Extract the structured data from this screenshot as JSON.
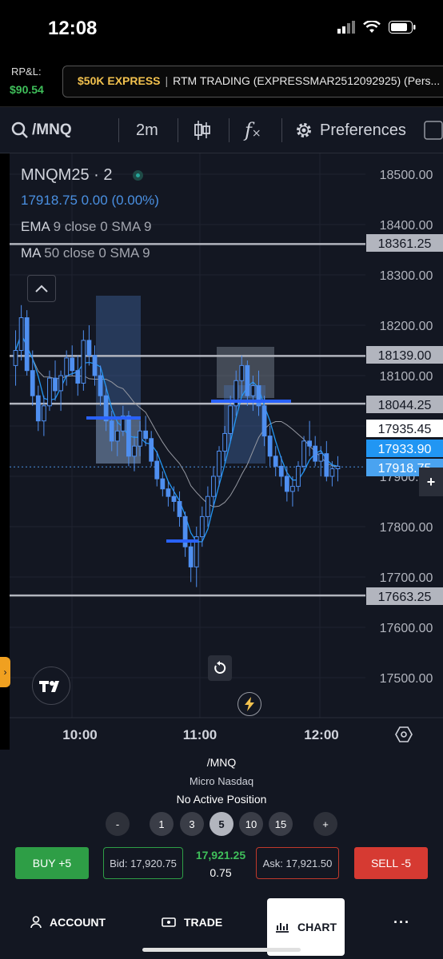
{
  "status_bar": {
    "time": "12:08"
  },
  "account": {
    "rpl_label": "RP&L:",
    "rpl_value": "$90.54",
    "express_label": "$50K EXPRESS",
    "separator": "|",
    "account_name": "RTM TRADING (EXPRESSMAR2512092925) (Pers..."
  },
  "toolbar": {
    "symbol": "/MNQ",
    "interval": "2m",
    "preferences_label": "Preferences",
    "fx_label": "f"
  },
  "legend": {
    "symbol_line": "MNQM25 · 2",
    "price_line": "17918.75  0.00 (0.00%)",
    "ema_label": "EMA",
    "ema_params": "9 close 0 SMA 9",
    "ma_label": "MA",
    "ma_params": "50 close 0 SMA 9"
  },
  "price_axis": {
    "ticks": [
      "18500.00",
      "18400.00",
      "18300.00",
      "18200.00",
      "18100.00",
      "17900.00",
      "17800.00",
      "17700.00",
      "17600.00",
      "17500.00"
    ],
    "labels": [
      {
        "text": "18361.25",
        "style": "gray"
      },
      {
        "text": "18139.00",
        "style": "gray"
      },
      {
        "text": "18044.25",
        "style": "gray"
      },
      {
        "text": "17935.45",
        "style": "white"
      },
      {
        "text": "17933.90",
        "style": "blue"
      },
      {
        "text": "17918.75",
        "style": "lightblue"
      },
      {
        "text": "17663.25",
        "style": "gray"
      }
    ]
  },
  "time_axis": {
    "ticks": [
      "10:00",
      "11:00",
      "12:00"
    ]
  },
  "chart_data": {
    "type": "candlestick",
    "symbol": "MNQM25",
    "interval": "2m",
    "y_range": [
      17450,
      18550
    ],
    "horizontal_levels": [
      18361.25,
      18139.0,
      18044.25,
      17663.25
    ],
    "candles": [
      [
        18120,
        18190,
        18080,
        18150
      ],
      [
        18150,
        18240,
        18130,
        18215
      ],
      [
        18215,
        18230,
        18100,
        18110
      ],
      [
        18110,
        18150,
        18040,
        18060
      ],
      [
        18060,
        18080,
        17990,
        18010
      ],
      [
        18010,
        18060,
        17980,
        18040
      ],
      [
        18040,
        18110,
        18030,
        18095
      ],
      [
        18095,
        18130,
        18050,
        18070
      ],
      [
        18070,
        18110,
        18030,
        18100
      ],
      [
        18100,
        18150,
        18080,
        18135
      ],
      [
        18135,
        18160,
        18100,
        18110
      ],
      [
        18110,
        18140,
        18060,
        18085
      ],
      [
        18085,
        18190,
        18070,
        18170
      ],
      [
        18170,
        18200,
        18120,
        18140
      ],
      [
        18140,
        18160,
        18080,
        18100
      ],
      [
        18100,
        18120,
        18040,
        18060
      ],
      [
        18060,
        18080,
        17990,
        18010
      ],
      [
        18010,
        18030,
        17950,
        17970
      ],
      [
        17970,
        18010,
        17940,
        17990
      ],
      [
        17990,
        18040,
        17980,
        18020
      ],
      [
        18020,
        18030,
        17920,
        17940
      ],
      [
        17940,
        17980,
        17910,
        17960
      ],
      [
        17960,
        18010,
        17940,
        17990
      ],
      [
        17990,
        18020,
        17960,
        17975
      ],
      [
        17975,
        17990,
        17920,
        17930
      ],
      [
        17930,
        17950,
        17880,
        17895
      ],
      [
        17895,
        17910,
        17860,
        17875
      ],
      [
        17875,
        17890,
        17840,
        17860
      ],
      [
        17860,
        17880,
        17830,
        17850
      ],
      [
        17850,
        17870,
        17800,
        17820
      ],
      [
        17820,
        17830,
        17740,
        17760
      ],
      [
        17760,
        17770,
        17690,
        17720
      ],
      [
        17720,
        17800,
        17680,
        17780
      ],
      [
        17780,
        17840,
        17760,
        17820
      ],
      [
        17820,
        17880,
        17800,
        17860
      ],
      [
        17860,
        17920,
        17840,
        17900
      ],
      [
        17900,
        17960,
        17880,
        17950
      ],
      [
        17950,
        18000,
        17930,
        17985
      ],
      [
        17985,
        18060,
        17970,
        18040
      ],
      [
        18040,
        18110,
        18020,
        18090
      ],
      [
        18090,
        18140,
        18060,
        18120
      ],
      [
        18120,
        18130,
        18040,
        18060
      ],
      [
        18060,
        18100,
        18030,
        18080
      ],
      [
        18080,
        18110,
        18020,
        18040
      ],
      [
        18040,
        18060,
        17960,
        17980
      ],
      [
        17980,
        18000,
        17920,
        17940
      ],
      [
        17940,
        17960,
        17900,
        17920
      ],
      [
        17920,
        17940,
        17880,
        17900
      ],
      [
        17900,
        17920,
        17850,
        17870
      ],
      [
        17870,
        17900,
        17840,
        17880
      ],
      [
        17880,
        17930,
        17870,
        17920
      ],
      [
        17920,
        17980,
        17910,
        17970
      ],
      [
        17970,
        18010,
        17940,
        17960
      ],
      [
        17960,
        17980,
        17920,
        17930
      ],
      [
        17930,
        17960,
        17900,
        17945
      ],
      [
        17945,
        17970,
        17890,
        17900
      ],
      [
        17900,
        17930,
        17880,
        17915
      ],
      [
        17915,
        17940,
        17890,
        17920
      ]
    ]
  }
}
